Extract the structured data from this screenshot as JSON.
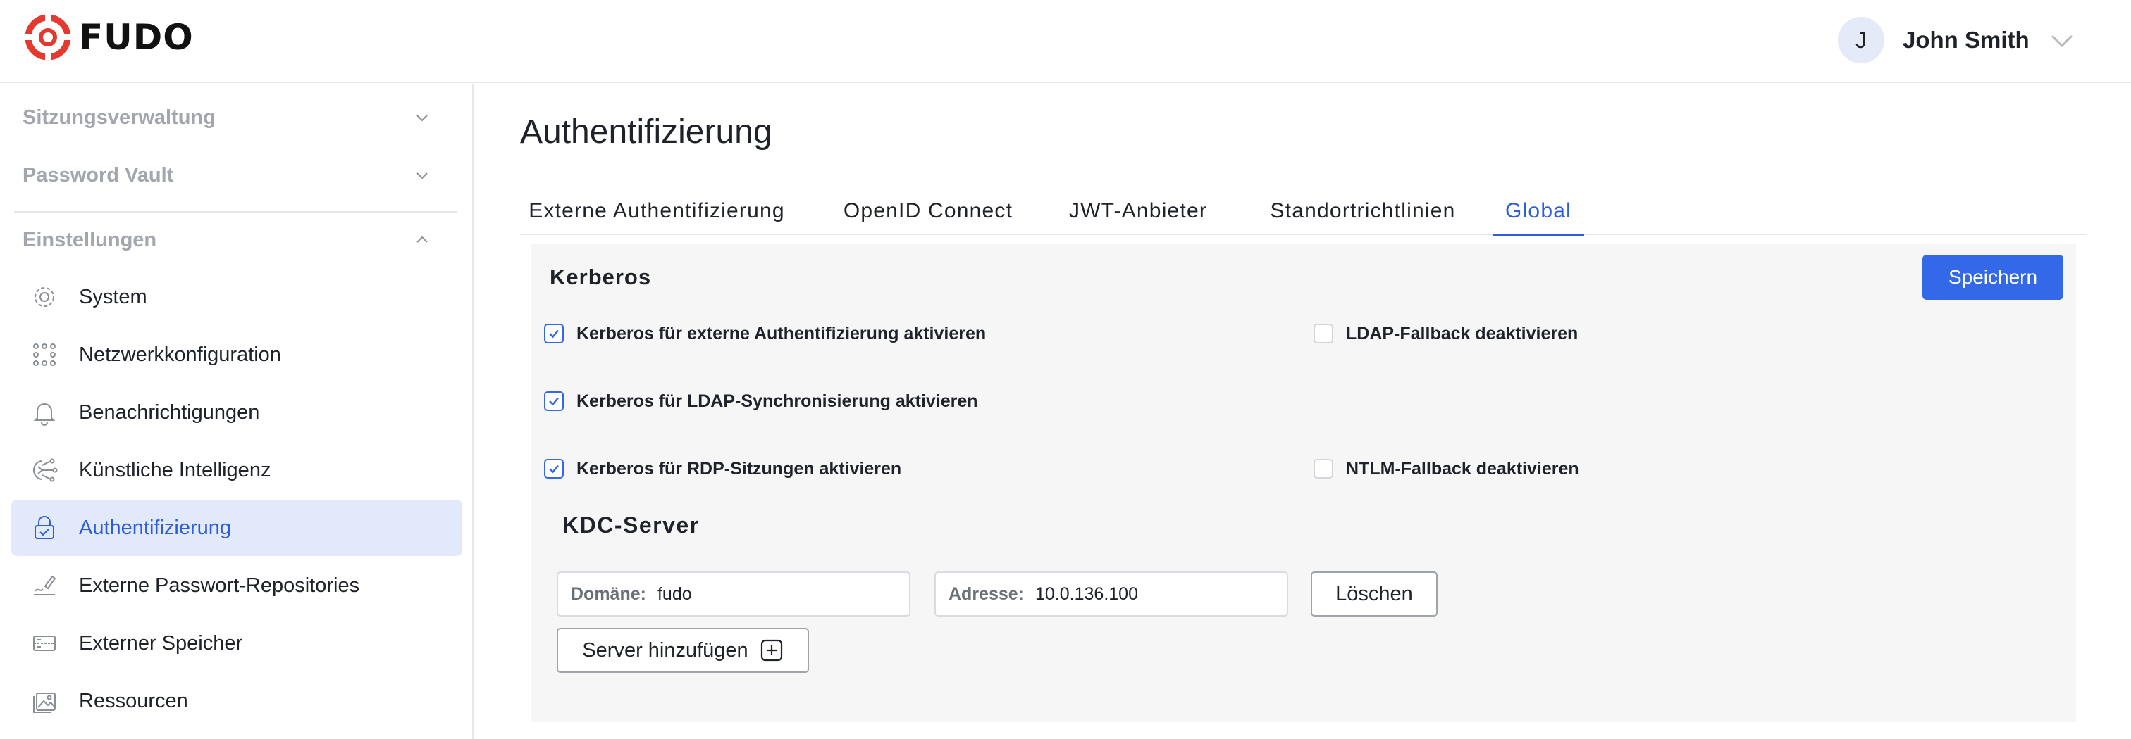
{
  "header": {
    "logo_text": "FUDO",
    "user": {
      "avatar_initial": "J",
      "name": "John Smith"
    }
  },
  "sidebar": {
    "groups": [
      {
        "label": "Sitzungsverwaltung",
        "expanded": false
      },
      {
        "label": "Password Vault",
        "expanded": false
      },
      {
        "label": "Einstellungen",
        "expanded": true
      }
    ],
    "items": [
      {
        "label": "System",
        "icon": "gear-icon"
      },
      {
        "label": "Netzwerkkonfiguration",
        "icon": "network-icon"
      },
      {
        "label": "Benachrichtigungen",
        "icon": "bell-icon"
      },
      {
        "label": "Künstliche Intelligenz",
        "icon": "ai-icon"
      },
      {
        "label": "Authentifizierung",
        "icon": "lock-check-icon",
        "active": true
      },
      {
        "label": "Externe Passwort-Repositories",
        "icon": "signature-icon"
      },
      {
        "label": "Externer Speicher",
        "icon": "storage-icon"
      },
      {
        "label": "Ressourcen",
        "icon": "image-icon"
      }
    ]
  },
  "main": {
    "title": "Authentifizierung",
    "tabs": [
      {
        "label": "Externe Authentifizierung"
      },
      {
        "label": "OpenID Connect"
      },
      {
        "label": "JWT-Anbieter"
      },
      {
        "label": "Standortrichtlinien"
      },
      {
        "label": "Global",
        "active": true
      }
    ],
    "kerberos": {
      "title": "Kerberos",
      "save_label": "Speichern",
      "options": [
        {
          "label": "Kerberos für externe Authentifizierung aktivieren",
          "checked": true
        },
        {
          "label": "LDAP-Fallback deaktivieren",
          "checked": false
        },
        {
          "label": "Kerberos für LDAP-Synchronisierung aktivieren",
          "checked": true
        },
        {
          "label": "Kerberos für RDP-Sitzungen aktivieren",
          "checked": true
        },
        {
          "label": "NTLM-Fallback deaktivieren",
          "checked": false
        }
      ]
    },
    "kdc": {
      "title": "KDC-Server",
      "servers": [
        {
          "domain_label": "Domäne:",
          "domain": "fudo",
          "address_label": "Adresse:",
          "address": "10.0.136.100",
          "delete_label": "Löschen"
        }
      ],
      "add_label": "Server hinzufügen"
    }
  },
  "colors": {
    "accent": "#3368e9",
    "active_bg": "#e2e9fa",
    "brand": "#e5392e"
  }
}
